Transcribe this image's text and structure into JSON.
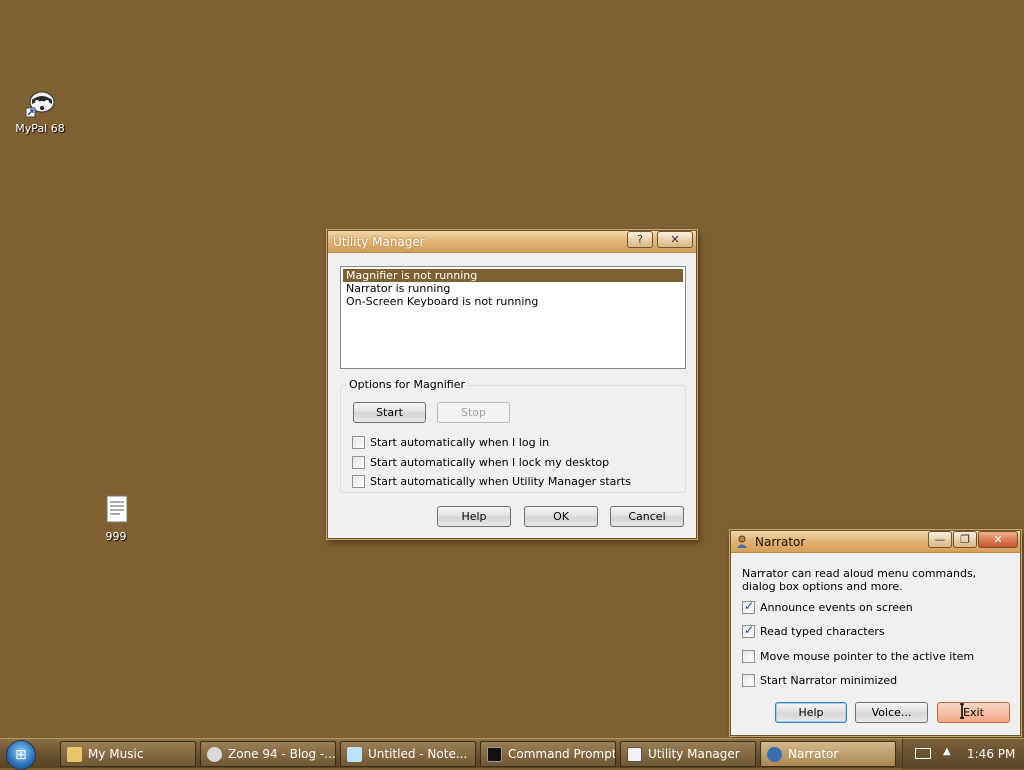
{
  "desktop": {
    "icons": [
      {
        "label": "MyPal 68"
      },
      {
        "label": "999"
      }
    ]
  },
  "utility_manager": {
    "title": "Utility Manager",
    "list_items": [
      "Magnifier is not running",
      "Narrator is running",
      "On-Screen Keyboard is not running"
    ],
    "options_group": "Options for Magnifier",
    "start_label": "Start",
    "stop_label": "Stop",
    "checkboxes": [
      {
        "label": "Start automatically when I log in",
        "checked": false
      },
      {
        "label": "Start automatically when I lock my desktop",
        "checked": false
      },
      {
        "label": "Start automatically when Utility Manager starts",
        "checked": false
      }
    ],
    "help_label": "Help",
    "ok_label": "OK",
    "cancel_label": "Cancel",
    "help_caption": "?",
    "close_caption": "✕"
  },
  "narrator": {
    "title": "Narrator",
    "description": "Narrator can read aloud menu commands, dialog box options and more.",
    "checkboxes": [
      {
        "label": "Announce events on screen",
        "checked": true
      },
      {
        "label": "Read typed characters",
        "checked": true
      },
      {
        "label": "Move mouse pointer to the active item",
        "checked": false
      },
      {
        "label": "Start Narrator minimized",
        "checked": false
      }
    ],
    "help_label": "Help",
    "voice_label": "Voice...",
    "exit_label": "Exit",
    "min_caption": "—",
    "max_caption": "❐",
    "close_caption": "✕"
  },
  "taskbar": {
    "items": [
      {
        "label": "My Music",
        "icon": "folder-icon"
      },
      {
        "label": "Zone 94 - Blog -...",
        "icon": "browser-icon"
      },
      {
        "label": "Untitled - Note...",
        "icon": "notepad-icon"
      },
      {
        "label": "Command Prompt",
        "icon": "cmd-icon"
      },
      {
        "label": "Utility Manager",
        "icon": "utility-icon"
      },
      {
        "label": "Narrator",
        "icon": "narrator-icon"
      }
    ],
    "clock": "1:46 PM"
  },
  "colors": {
    "desktop": "#7e6032",
    "titlebar": "#e2b577",
    "selection": "#7e6032"
  }
}
